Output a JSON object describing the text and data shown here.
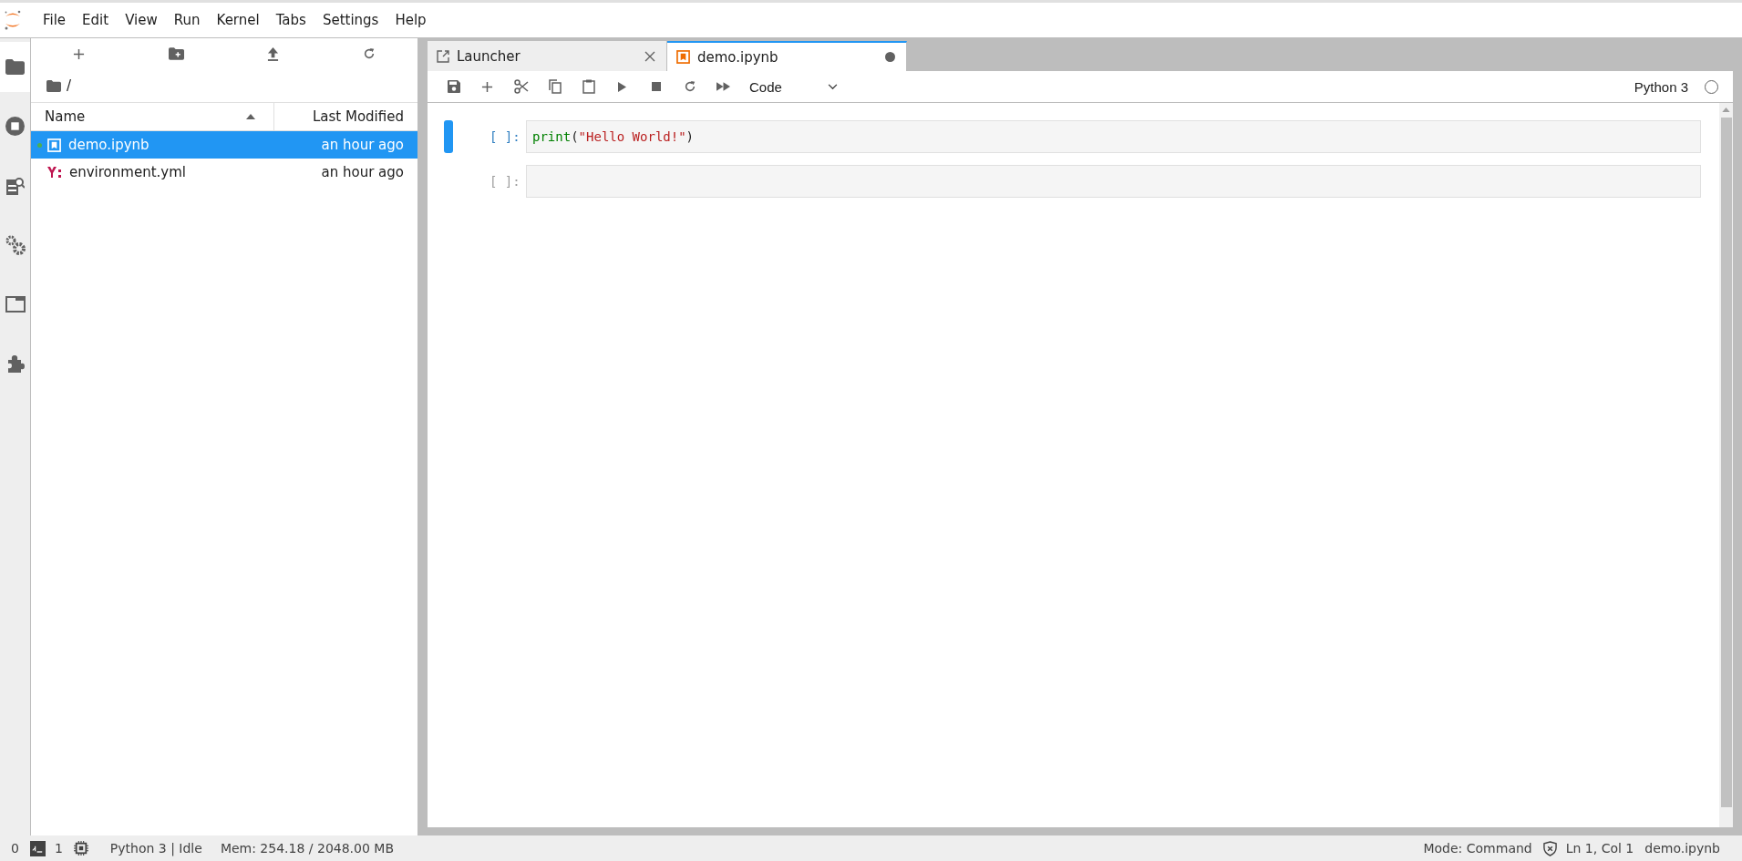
{
  "menu_bar": {
    "items": [
      "File",
      "Edit",
      "View",
      "Run",
      "Kernel",
      "Tabs",
      "Settings",
      "Help"
    ]
  },
  "left_sidebar": {
    "tabs": [
      {
        "selected": true
      },
      {
        "selected": false
      },
      {
        "selected": false
      },
      {
        "selected": false
      },
      {
        "selected": false
      },
      {
        "selected": false
      }
    ]
  },
  "file_browser": {
    "breadcrumb": "/",
    "columns": [
      "Name",
      "Last Modified"
    ],
    "files": [
      {
        "name": "demo.ipynb",
        "modified": "an hour ago",
        "kind": "notebook",
        "selected": true,
        "running": true
      },
      {
        "name": "environment.yml",
        "modified": "an hour ago",
        "kind": "yaml",
        "selected": false,
        "running": false
      }
    ]
  },
  "tabs": [
    {
      "label": "Launcher",
      "kind": "launcher",
      "selected": false,
      "dirty": false
    },
    {
      "label": "demo.ipynb",
      "kind": "notebook",
      "selected": true,
      "dirty": true
    }
  ],
  "toolbar": {
    "cell_type": "Code",
    "kernel": "Python 3",
    "kernel_busy": false
  },
  "cells": [
    {
      "prompt": "[ ]:",
      "active": true,
      "tokens": [
        {
          "text": "print",
          "kind": "builtin"
        },
        {
          "text": "(",
          "kind": "punct"
        },
        {
          "text": "\"Hello World!\"",
          "kind": "string"
        },
        {
          "text": ")",
          "kind": "punct"
        }
      ]
    },
    {
      "prompt": "[ ]:",
      "active": false
    }
  ],
  "status_bar": {
    "terminals": "0",
    "kernels": "1",
    "kernel_status": "Python 3 | Idle",
    "memory": "Mem: 254.18 / 2048.00 MB",
    "mode": "Mode: Command",
    "position": "Ln 1, Col 1",
    "file": "demo.ipynb"
  }
}
